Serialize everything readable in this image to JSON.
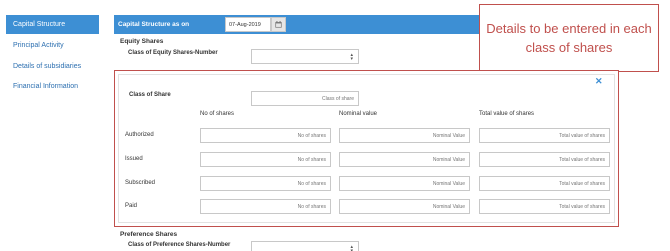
{
  "sidebar": {
    "items": [
      {
        "label": "Capital Structure"
      },
      {
        "label": "Principal Activity"
      },
      {
        "label": "Details of subsidiaries"
      },
      {
        "label": "Financial Information"
      }
    ]
  },
  "header": {
    "label": "Capital Structure as on",
    "date_value": "07-Aug-2019"
  },
  "equity": {
    "title": "Equity Shares",
    "class_label": "Class of Equity Shares-Number"
  },
  "callout": {
    "text": "Details to be entered in each class of shares"
  },
  "modal": {
    "class_label": "Class of Share",
    "class_placeholder": "Class of share",
    "columns": [
      "No of shares",
      "Nominal value",
      "Total value of shares"
    ],
    "rows": [
      {
        "label": "Authorized"
      },
      {
        "label": "Issued"
      },
      {
        "label": "Subscribed"
      },
      {
        "label": "Paid"
      }
    ],
    "placeholders": [
      "No of shares",
      "Nominal Value",
      "Total value of shares"
    ]
  },
  "preference": {
    "title": "Preference Shares",
    "class_label": "Class of Preference Shares-Number"
  }
}
